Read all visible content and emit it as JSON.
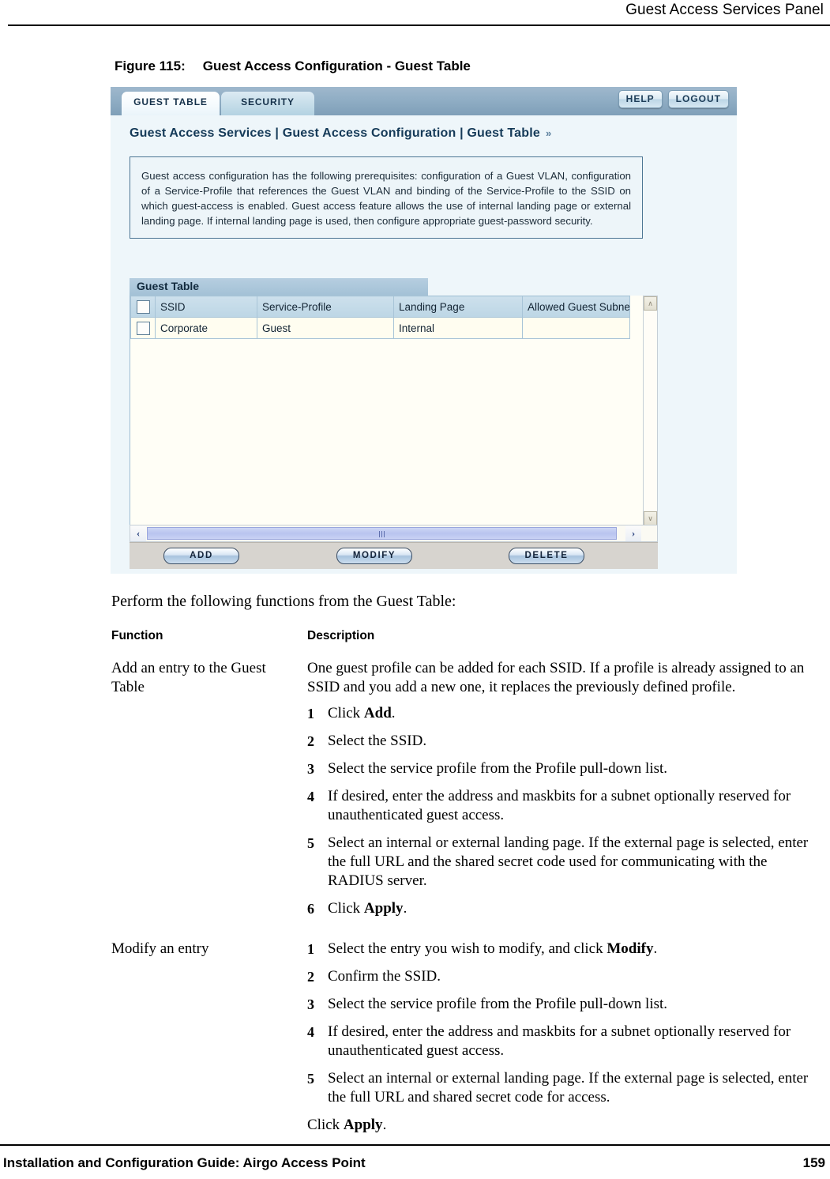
{
  "page_header": {
    "title": "Guest Access Services Panel"
  },
  "figure": {
    "number": "Figure 115:",
    "caption": "Guest Access Configuration - Guest Table"
  },
  "app": {
    "tabs": [
      {
        "label": "GUEST TABLE",
        "active": true
      },
      {
        "label": "SECURITY",
        "active": false
      }
    ],
    "top_buttons": [
      {
        "label": "HELP"
      },
      {
        "label": "LOGOUT"
      }
    ],
    "breadcrumb": "Guest Access Services | Guest Access Configuration | Guest Table",
    "breadcrumb_chevron": "»",
    "info_text": "Guest access configuration has the following prerequisites: configuration of a Guest VLAN, configuration of a Service-Profile that references the Guest VLAN and binding of the Service-Profile to the SSID on which guest-access is enabled. Guest access feature allows the use of internal landing page or external landing page. If internal landing page is used, then configure appropriate guest-password security.",
    "table": {
      "title": "Guest Table",
      "columns": [
        "SSID",
        "Service-Profile",
        "Landing Page",
        "Allowed Guest Subnet"
      ],
      "rows": [
        {
          "ssid": "Corporate",
          "service_profile": "Guest",
          "landing_page": "Internal",
          "allowed_guest_subnet": ""
        }
      ]
    },
    "action_buttons": [
      {
        "label": "ADD"
      },
      {
        "label": "MODIFY"
      },
      {
        "label": "DELETE"
      }
    ],
    "scroll": {
      "up_arrow": "∧",
      "down_arrow": "∨",
      "left_arrow": "‹",
      "right_arrow": "›"
    },
    "colors": {
      "tabbar": "#8fadc4",
      "active_tab": "#ffffff",
      "inactive_tab": "#c5dde9",
      "panel_bg": "#eef6fa",
      "table_header": "#bcd6e5",
      "table_row": "#fffdf0",
      "button_bar": "#d7d4cf"
    }
  },
  "body": {
    "intro": "Perform the following functions from the Guest Table:",
    "table_headers": {
      "function": "Function",
      "description": "Description"
    },
    "entries": [
      {
        "function": "Add an entry to the Guest Table",
        "intro_paragraph": "One guest profile can be added for each SSID. If a profile is already assigned to an SSID and you add a new one, it replaces the previously defined profile.",
        "steps": [
          "Click Add.",
          "Select the SSID.",
          "Select the service profile from the Profile pull-down list.",
          "If desired, enter the address and maskbits for a subnet optionally reserved for unauthenticated guest access.",
          "Select an internal or external landing page. If the external page is selected, enter the full URL and the shared secret code used for communicating with the RADIUS server.",
          "Click Apply."
        ],
        "trailing_line": ""
      },
      {
        "function": "Modify an entry",
        "intro_paragraph": "",
        "steps": [
          "Select the entry you wish to modify, and click Modify.",
          "Confirm the SSID.",
          "Select the service profile from the Profile pull-down list.",
          "If desired, enter the address and maskbits for a subnet optionally reserved for unauthenticated guest access.",
          "Select an internal or external landing page. If the external page is selected, enter the full URL and shared secret code for access."
        ],
        "trailing_line": "Click Apply."
      }
    ]
  },
  "footer": {
    "left": "Installation and Configuration Guide: Airgo Access Point",
    "page_number": "159"
  }
}
